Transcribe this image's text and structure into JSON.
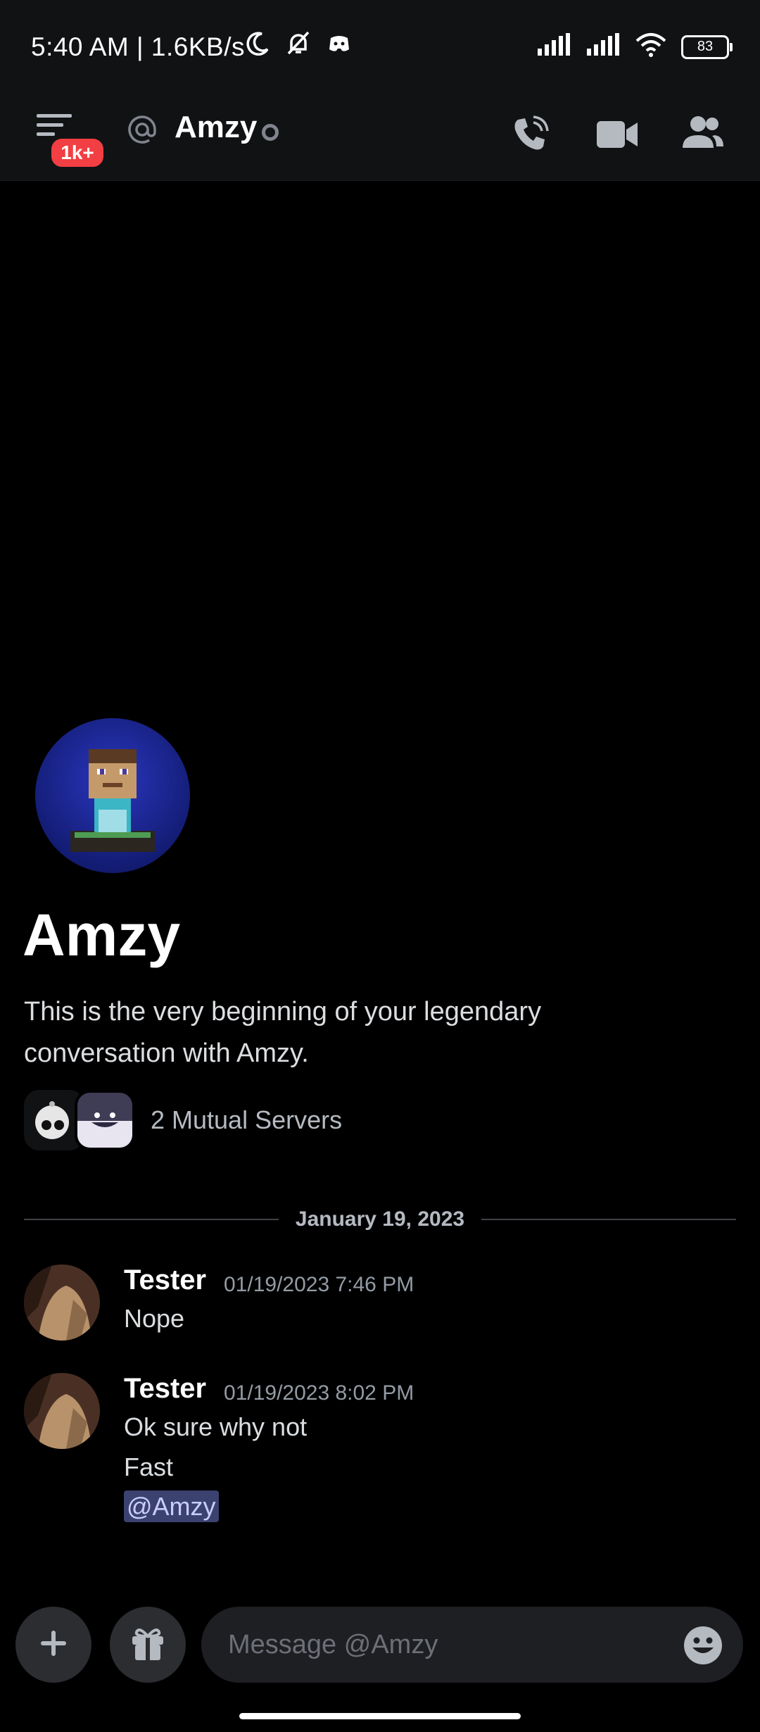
{
  "statusbar": {
    "time": "5:40 AM | 1.6KB/s",
    "battery": "83"
  },
  "header": {
    "badge": "1k+",
    "channel_name": "Amzy"
  },
  "profile": {
    "name": "Amzy",
    "intro": "This is the very beginning of your legendary conversation with Amzy.",
    "mutual_servers": "2 Mutual Servers"
  },
  "divider": {
    "date": "January 19, 2023"
  },
  "messages": [
    {
      "author": "Tester",
      "time": "01/19/2023 7:46 PM",
      "lines": [
        "Nope"
      ]
    },
    {
      "author": "Tester",
      "time": "01/19/2023 8:02 PM",
      "lines": [
        "Ok sure why not",
        "Fast"
      ],
      "mention": "@Amzy"
    }
  ],
  "composer": {
    "placeholder": "Message @Amzy"
  },
  "colors": {
    "background": "#000000",
    "header": "#111214",
    "badge": "#f23f43",
    "mention_bg": "#3c4270",
    "mention_text": "#c9cdfb"
  },
  "icons": [
    "moon-icon",
    "muted-bell-icon",
    "discord-icon",
    "signal-icon",
    "wifi-icon",
    "battery-icon",
    "menu-icon",
    "at-icon",
    "phone-call-icon",
    "video-icon",
    "members-icon",
    "plus-icon",
    "gift-icon",
    "emoji-icon"
  ]
}
